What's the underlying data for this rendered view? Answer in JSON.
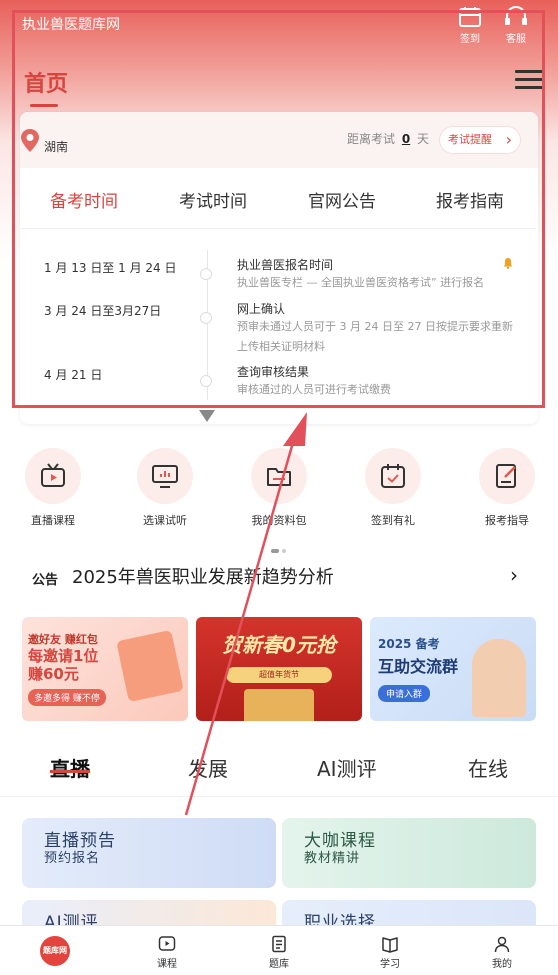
{
  "header": {
    "site_name": "执业兽医题库网",
    "checkin_label": "签到",
    "service_label": "客服",
    "home_title": "首页"
  },
  "location": {
    "city": "湖南",
    "countdown_prefix": "距离考试",
    "countdown_days": "0",
    "countdown_suffix": "天",
    "remind_button": "考试提醒"
  },
  "info_tabs": [
    {
      "label": "备考时间",
      "active": true
    },
    {
      "label": "考试时间",
      "active": false
    },
    {
      "label": "官网公告",
      "active": false
    },
    {
      "label": "报考指南",
      "active": false
    }
  ],
  "timeline": [
    {
      "date": "1 月 13 日至 1 月 24 日",
      "title": "执业兽医报名时间",
      "desc": "执业兽医专栏 — 全国执业兽医资格考试” 进行报名"
    },
    {
      "date": "3 月 24 日至3月27日",
      "title": "网上确认",
      "desc": "预审未通过人员可于 3 月 24 日至 27 日按提示要求重新上传相关证明材料"
    },
    {
      "date": "4 月 21 日",
      "title": "查询审核结果",
      "desc": "审核通过的人员可进行考试缴费"
    }
  ],
  "quick_links": [
    {
      "label": "直播课程",
      "icon": "tv-icon"
    },
    {
      "label": "选课试听",
      "icon": "monitor-chart-icon"
    },
    {
      "label": "我的资料包",
      "icon": "folder-icon"
    },
    {
      "label": "签到有礼",
      "icon": "calendar-check-icon"
    },
    {
      "label": "报考指导",
      "icon": "document-pen-icon"
    }
  ],
  "notice": {
    "tag": "公告",
    "text": "2025年兽医职业发展新趋势分析"
  },
  "banners": [
    {
      "line1": "邀好友 赚红包",
      "line2": "每邀请1位赚60元",
      "line3": "多邀多得 赚不停"
    },
    {
      "line1": "贺新春0元抢",
      "line2": "超值年货节"
    },
    {
      "line1": "2025 备考",
      "line2": "互助交流群",
      "line3": "申请入群"
    }
  ],
  "content_tabs": [
    {
      "label": "直播",
      "active": true
    },
    {
      "label": "发展",
      "active": false
    },
    {
      "label": "AI测评",
      "active": false
    },
    {
      "label": "在线",
      "active": false
    }
  ],
  "tiles": [
    {
      "title": "直播预告",
      "subtitle": "预约报名"
    },
    {
      "title": "大咖课程",
      "subtitle": "教材精讲"
    },
    {
      "title": "AI测评",
      "subtitle": ""
    },
    {
      "title": "职业选择",
      "subtitle": ""
    }
  ],
  "tabbar": {
    "logo_text": "题库网",
    "items": [
      {
        "label": "课程",
        "icon": "play-circle-icon"
      },
      {
        "label": "题库",
        "icon": "document-icon"
      },
      {
        "label": "学习",
        "icon": "book-icon"
      },
      {
        "label": "我的",
        "icon": "user-icon"
      }
    ]
  },
  "colors": {
    "brand_red": "#d6463f",
    "annotation_red": "#e2505a"
  }
}
